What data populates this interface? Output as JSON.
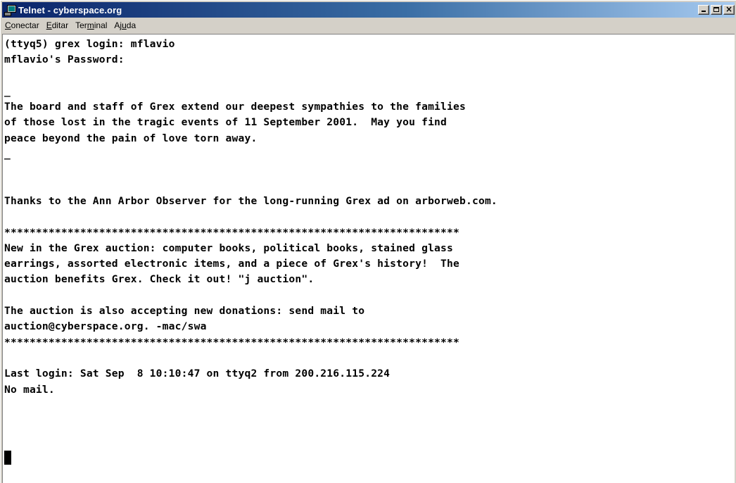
{
  "window": {
    "title": "Telnet - cyberspace.org",
    "icon": "telnet-icon",
    "controls": [
      "minimize-icon",
      "maximize-icon",
      "close-icon"
    ],
    "close_glyph": "×"
  },
  "menu": {
    "items": [
      {
        "key": "C",
        "rest": "onectar"
      },
      {
        "key": "E",
        "rest": "ditar"
      },
      {
        "pre": "Ter",
        "key": "m",
        "rest": "inal"
      },
      {
        "pre": "Aj",
        "key": "u",
        "rest": "da"
      }
    ]
  },
  "terminal": {
    "lines": [
      "(ttyq5) grex login: mflavio",
      "mflavio's Password:",
      "",
      "_",
      "The board and staff of Grex extend our deepest sympathies to the families",
      "of those lost in the tragic events of 11 September 2001.  May you find",
      "peace beyond the pain of love torn away.",
      "_",
      "",
      "",
      "Thanks to the Ann Arbor Observer for the long-running Grex ad on arborweb.com.",
      "",
      "************************************************************************",
      "New in the Grex auction: computer books, political books, stained glass",
      "earrings, assorted electronic items, and a piece of Grex's history!  The",
      "auction benefits Grex. Check it out! \"j auction\".",
      "",
      "The auction is also accepting new donations: send mail to",
      "auction@cyberspace.org. -mac/swa",
      "************************************************************************",
      "",
      "Last login: Sat Sep  8 10:10:47 on ttyq2 from 200.216.115.224",
      "No mail."
    ]
  }
}
